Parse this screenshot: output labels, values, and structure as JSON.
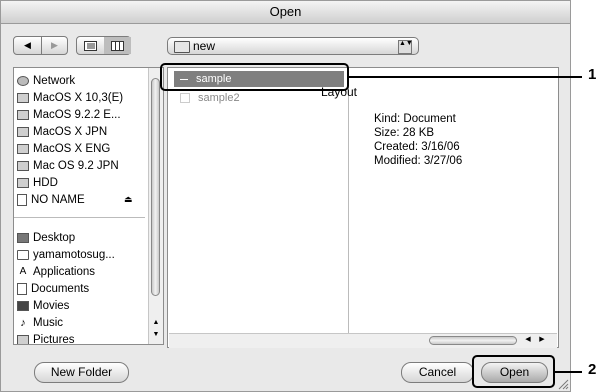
{
  "window": {
    "title": "Open"
  },
  "toolbar": {
    "back_icon": "◀",
    "forward_icon": "▶",
    "path": "new",
    "popup_arrows": "▲▼"
  },
  "sidebar": {
    "devices": [
      {
        "label": "Network",
        "icon": "globe-icon"
      },
      {
        "label": "MacOS X 10,3(E)",
        "icon": "hard-disk-icon"
      },
      {
        "label": "MacOS 9.2.2 E...",
        "icon": "hard-disk-icon"
      },
      {
        "label": "MacOS X JPN",
        "icon": "hard-disk-icon"
      },
      {
        "label": "MacOS X ENG",
        "icon": "hard-disk-icon"
      },
      {
        "label": "Mac OS 9.2 JPN",
        "icon": "hard-disk-icon"
      },
      {
        "label": "HDD",
        "icon": "hard-disk-icon"
      },
      {
        "label": "NO NAME",
        "icon": "removable-disk-icon"
      }
    ],
    "eject_glyph": "⏏",
    "places": [
      {
        "label": "Desktop",
        "icon": "desktop-icon"
      },
      {
        "label": "yamamotosug...",
        "icon": "home-icon"
      },
      {
        "label": "Applications",
        "icon": "applications-icon"
      },
      {
        "label": "Documents",
        "icon": "documents-icon"
      },
      {
        "label": "Movies",
        "icon": "movies-icon"
      },
      {
        "label": "Music",
        "icon": "music-icon"
      },
      {
        "label": "Pictures",
        "icon": "pictures-icon"
      }
    ]
  },
  "browser": {
    "files": [
      {
        "name": "sample",
        "selected": true
      },
      {
        "name": "sample2",
        "selected": false
      }
    ],
    "preview": {
      "title": "Layout",
      "kind": "Kind: Document",
      "size": "Size: 28 KB",
      "created": "Created: 3/16/06",
      "modified": "Modified: 3/27/06"
    }
  },
  "buttons": {
    "new_folder": "New Folder",
    "cancel": "Cancel",
    "open": "Open"
  },
  "callouts": {
    "one": "1",
    "two": "2"
  }
}
